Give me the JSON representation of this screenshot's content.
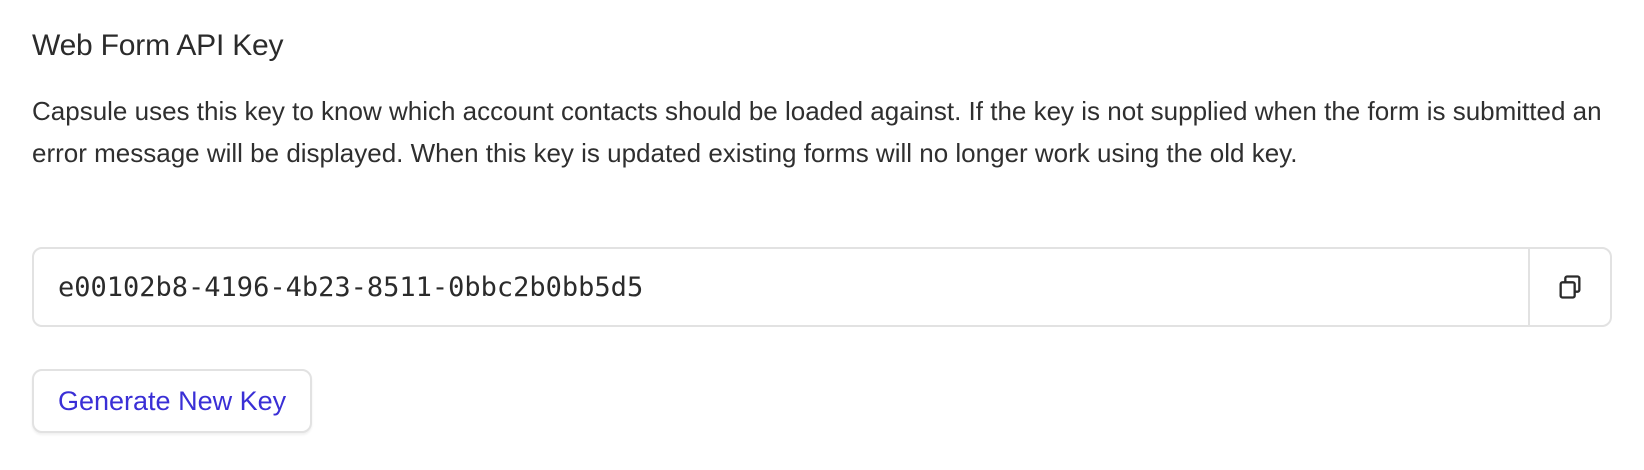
{
  "section": {
    "title": "Web Form API Key",
    "description": "Capsule uses this key to know which account contacts should be loaded against. If the key is not supplied when the form is submitted an error message will be displayed. When this key is updated existing forms will no longer work using the old key."
  },
  "api_key": {
    "value": "e00102b8-4196-4b23-8511-0bbc2b0bb5d5",
    "copy_icon": "copy-icon"
  },
  "actions": {
    "generate_label": "Generate New Key"
  },
  "colors": {
    "link_accent": "#3a2fd6",
    "border": "#e2e2e2",
    "text": "#2b2b2b"
  }
}
